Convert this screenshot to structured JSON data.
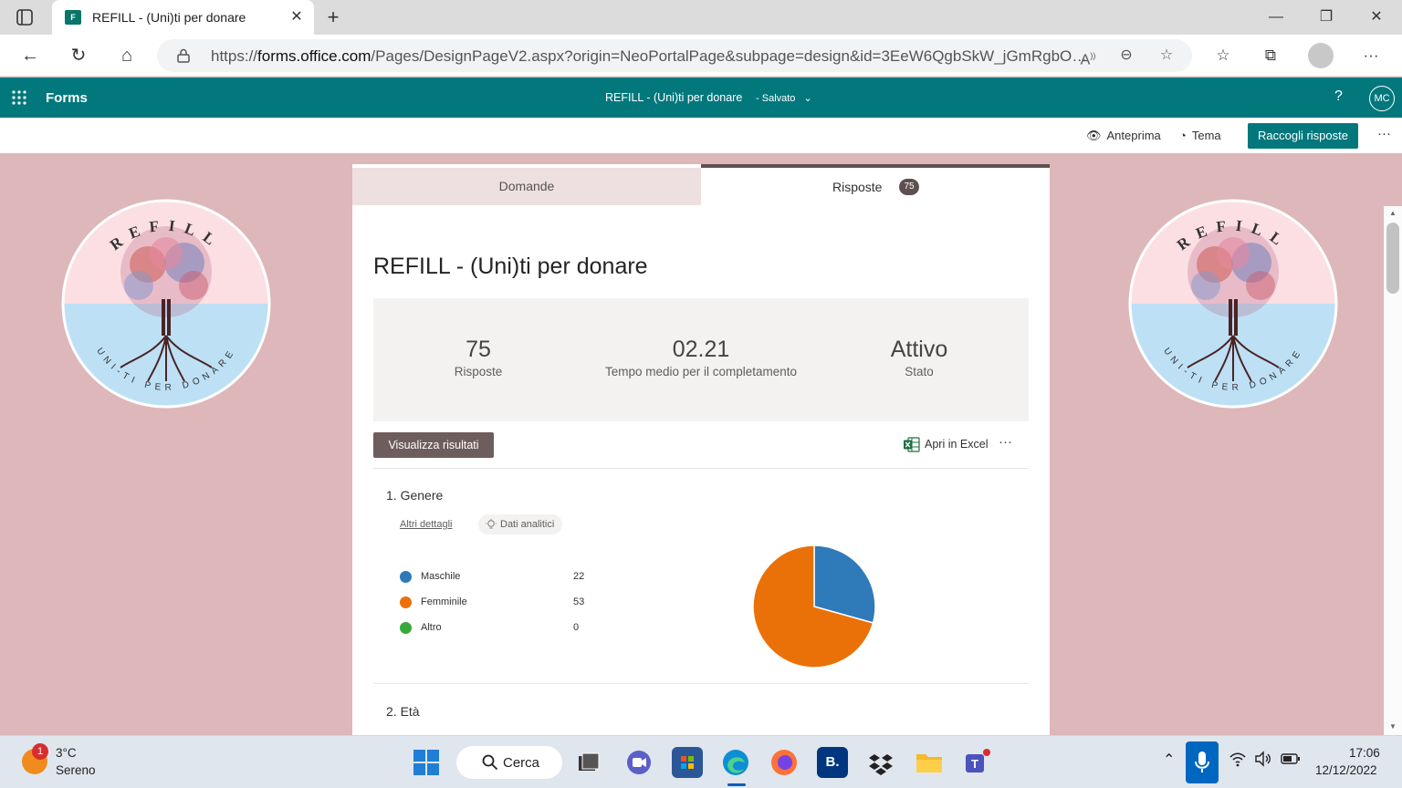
{
  "browser": {
    "tab_title": "REFILL - (Uni)ti per donare",
    "tab_favicon": "F",
    "url_domain": "forms.office.com",
    "url_prefix": "https://",
    "url_path": "/Pages/DesignPageV2.aspx?origin=NeoPortalPage&subpage=design&id=3EeW6QgbSkW_jGmRgbO…",
    "icons": [
      "tab-actions-icon",
      "close-icon",
      "plus-icon",
      "minimize-icon",
      "restore-icon",
      "back-icon",
      "refresh-icon",
      "home-icon",
      "lock-icon",
      "read-aloud-icon",
      "zoom-icon",
      "add-favorite-icon",
      "favorites-icon",
      "collections-icon",
      "profile-icon",
      "more-icon"
    ]
  },
  "app": {
    "name": "Forms",
    "form_title": "REFILL - (Uni)ti per donare",
    "status": "Salvato",
    "help": "?",
    "avatar_initials": "MC",
    "theme_color": "#03787c"
  },
  "commands": {
    "preview": "Anteprima",
    "theme": "Tema",
    "collect": "Raccogli risposte",
    "more": "···"
  },
  "logo": {
    "top_text": "REFILL",
    "bottom_text": "UNI-TI PER DONARE"
  },
  "tabs": {
    "questions": "Domande",
    "responses": "Risposte",
    "responses_count": "75"
  },
  "form": {
    "title": "REFILL - (Uni)ti per donare",
    "stats": [
      {
        "value": "75",
        "label": "Risposte"
      },
      {
        "value": "02.21",
        "label": "Tempo medio per il completamento"
      },
      {
        "value": "Attivo",
        "label": "Stato"
      }
    ],
    "view_results": "Visualizza risultati",
    "open_excel": "Apri in Excel",
    "more": "···"
  },
  "questions": [
    {
      "title": "1.  Genere",
      "details_link": "Altri dettagli",
      "insights": "Dati analitici",
      "legend": [
        {
          "name": "Maschile",
          "count": "22",
          "color": "#2f7ab9"
        },
        {
          "name": "Femminile",
          "count": "53",
          "color": "#ea7107"
        },
        {
          "name": "Altro",
          "count": "0",
          "color": "#38a83a"
        }
      ]
    },
    {
      "title": "2.  Età"
    }
  ],
  "chart_data": {
    "type": "pie",
    "categories": [
      "Maschile",
      "Femminile",
      "Altro"
    ],
    "values": [
      22,
      53,
      0
    ],
    "colors": [
      "#2f7ab9",
      "#ea7107",
      "#38a83a"
    ],
    "legend": "left"
  },
  "taskbar": {
    "weather_temp": "3°C",
    "weather_desc": "Sereno",
    "weather_badge": "1",
    "search_label": "Cerca",
    "apps": [
      "file-explorer-icon",
      "teams-meet-icon",
      "store-icon",
      "edge-icon",
      "firefox-icon",
      "booking-icon",
      "dropbox-icon",
      "folder-icon",
      "teams-icon"
    ],
    "booking_letter": "B.",
    "time": "17:06",
    "date": "12/12/2022"
  }
}
